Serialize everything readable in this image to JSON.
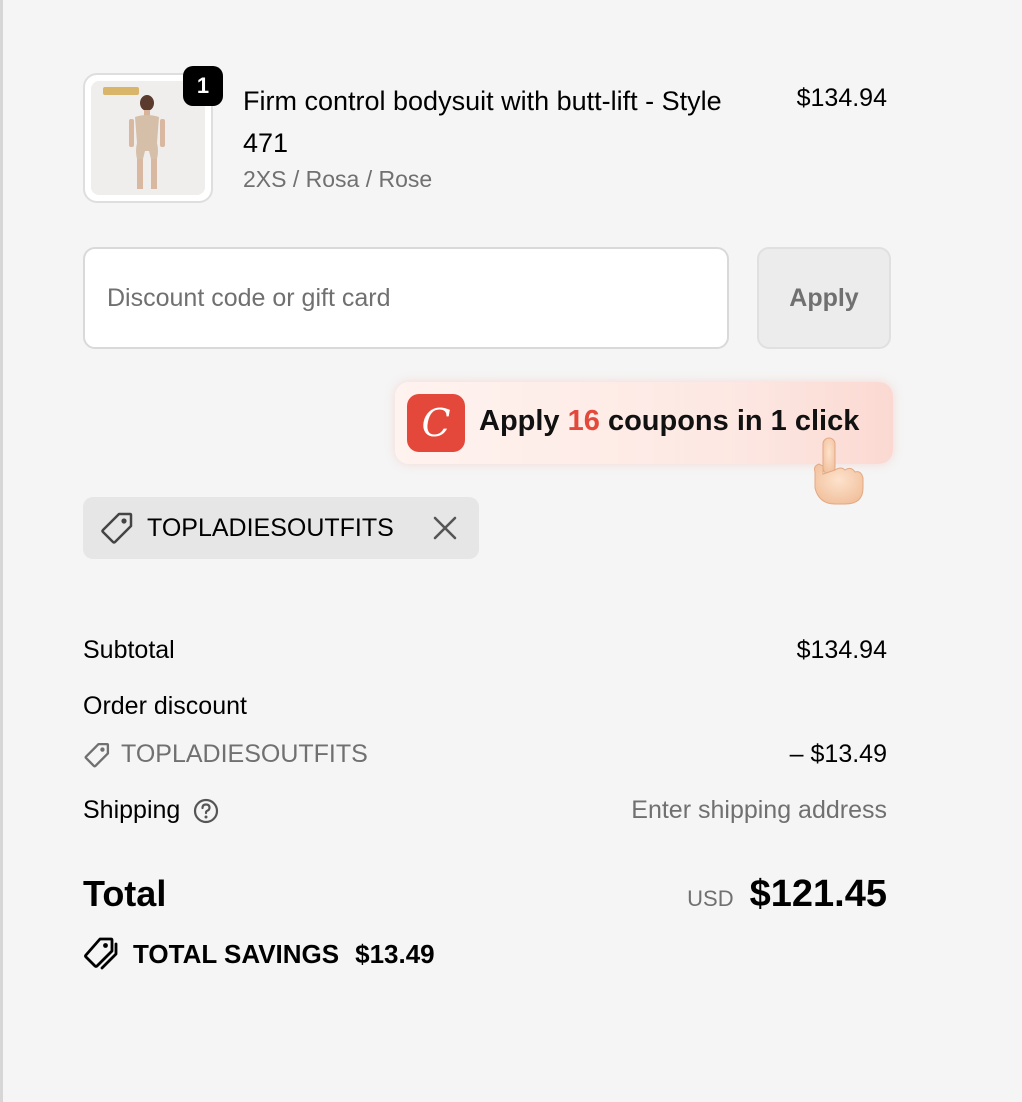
{
  "product": {
    "quantity": "1",
    "title": "Firm control bodysuit with butt-lift - Style 471",
    "variant": "2XS / Rosa / Rose",
    "price": "$134.94",
    "image_icon": "bodysuit-product-image"
  },
  "discount": {
    "placeholder": "Discount code or gift card",
    "value": "",
    "apply_label": "Apply"
  },
  "coupon_banner": {
    "logo_letter": "C",
    "text_before": "Apply ",
    "count": "16",
    "text_after": " coupons in 1 click",
    "accent_color": "#e4483a"
  },
  "applied_code": {
    "code": "TOPLADIESOUTFITS",
    "icon": "tag-icon",
    "remove_icon": "close-icon"
  },
  "summary": {
    "subtotal_label": "Subtotal",
    "subtotal_value": "$134.94",
    "order_discount_label": "Order discount",
    "discount_code": "TOPLADIESOUTFITS",
    "discount_value": "– $13.49",
    "shipping_label": "Shipping",
    "shipping_value": "Enter shipping address",
    "total_label": "Total",
    "currency": "USD",
    "total_value": "$121.45",
    "savings_label": "TOTAL SAVINGS",
    "savings_value": "$13.49"
  }
}
